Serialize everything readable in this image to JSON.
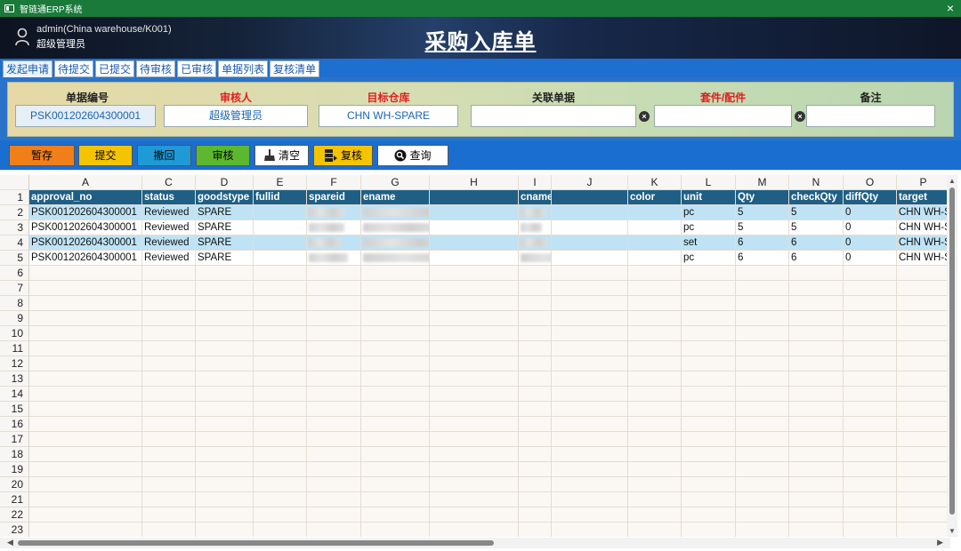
{
  "window": {
    "title": "智链通ERP系统",
    "close_icon": "×"
  },
  "header": {
    "user_name": "admin(China warehouse/K001)",
    "user_role": "超级管理员",
    "page_title": "采购入库单"
  },
  "tabs": [
    "发起申请",
    "待提交",
    "已提交",
    "待审核",
    "已审核",
    "单据列表",
    "复核清单"
  ],
  "form": {
    "fields": [
      {
        "label": "单据编号",
        "value": "PSK001202604300001",
        "label_color": "black"
      },
      {
        "label": "审核人",
        "value": "超级管理员",
        "label_color": "red"
      },
      {
        "label": "目标仓库",
        "value": "CHN WH-SPARE",
        "label_color": "red"
      },
      {
        "label": "关联单据",
        "value": "",
        "label_color": "black"
      },
      {
        "label": "套件/配件",
        "value": "",
        "label_color": "red"
      },
      {
        "label": "备注",
        "value": "",
        "label_color": "black"
      }
    ]
  },
  "toolbar": {
    "buttons": [
      {
        "label": "暂存",
        "bg": "#f07f1a",
        "icon": ""
      },
      {
        "label": "提交",
        "bg": "#f5c400",
        "icon": ""
      },
      {
        "label": "撤回",
        "bg": "#1e9ad6",
        "icon": ""
      },
      {
        "label": "审核",
        "bg": "#5cb82e",
        "icon": ""
      },
      {
        "label": "清空",
        "bg": "#ffffff",
        "icon": "broom-icon"
      },
      {
        "label": "复核",
        "bg": "#f5c400",
        "icon": "stack-icon"
      },
      {
        "label": "查询",
        "bg": "#ffffff",
        "icon": "magnifier-icon"
      }
    ]
  },
  "sheet": {
    "column_letters": [
      "A",
      "C",
      "D",
      "E",
      "F",
      "G",
      "H",
      "I",
      "J",
      "K",
      "L",
      "M",
      "N",
      "O",
      "P"
    ],
    "headers": [
      "approval_no",
      "status",
      "goodstype",
      "fullid",
      "spareid",
      "ename",
      "",
      "cname",
      "",
      "color",
      "unit",
      "Qty",
      "checkQty",
      "diffQty",
      "target"
    ],
    "rows": [
      [
        "PSK001202604300001",
        "Reviewed",
        "SPARE",
        "",
        "",
        "",
        "",
        "",
        "",
        "",
        "pc",
        "5",
        "5",
        "0",
        "CHN WH-SPARE"
      ],
      [
        "PSK001202604300001",
        "Reviewed",
        "SPARE",
        "",
        "",
        "",
        "",
        "",
        "",
        "",
        "pc",
        "5",
        "5",
        "0",
        "CHN WH-SPARE"
      ],
      [
        "PSK001202604300001",
        "Reviewed",
        "SPARE",
        "",
        "",
        "",
        "",
        "",
        "",
        "",
        "set",
        "6",
        "6",
        "0",
        "CHN WH-SPARE"
      ],
      [
        "PSK001202604300001",
        "Reviewed",
        "SPARE",
        "",
        "",
        "",
        "",
        "",
        "",
        "",
        "pc",
        "6",
        "6",
        "0",
        "CHN WH-SPARE"
      ]
    ],
    "row_numbers": [
      "1",
      "2",
      "3",
      "4",
      "5",
      "6",
      "7",
      "8",
      "9",
      "10",
      "11",
      "12",
      "13",
      "14",
      "15",
      "16",
      "17",
      "18",
      "19",
      "20",
      "21",
      "22",
      "23"
    ]
  },
  "colors": {
    "header_row": "#1f5f86",
    "alt_row": "#bfe3f5",
    "titlebar": "#1a7a3a",
    "tabs_bg": "#1e6fd0"
  }
}
